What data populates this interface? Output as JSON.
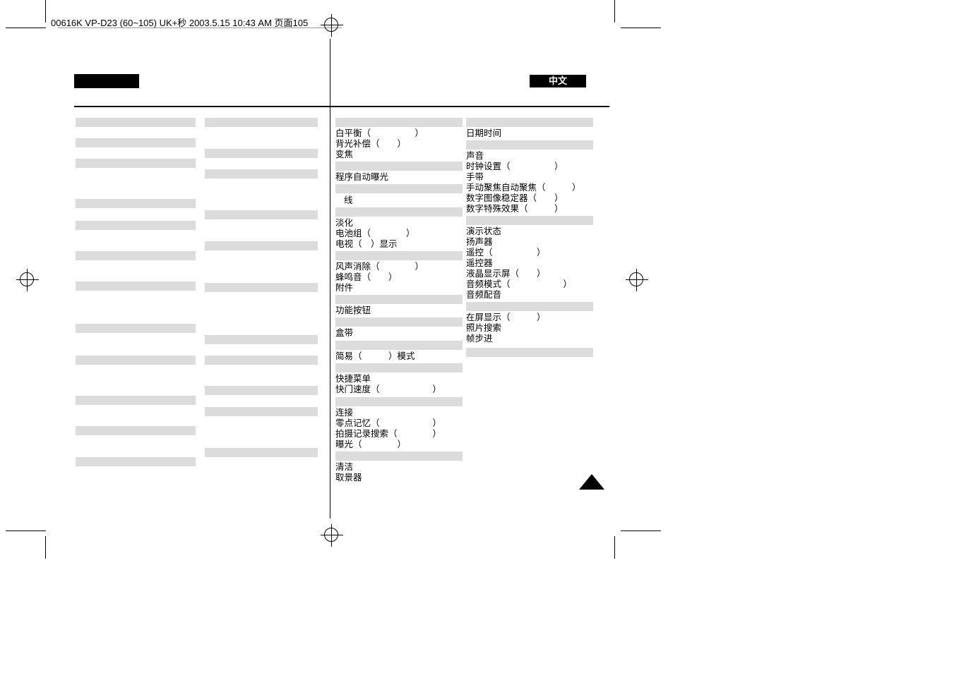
{
  "header": {
    "crop_label": "00616K VP-D23 (60~105) UK+秒  2003.5.15 10:43 AM  页面105"
  },
  "lang_tab": "中文",
  "col3": {
    "g1": "",
    "e1": "白平衡（　　　　　）",
    "e2": "背光补偿（　　）",
    "e3": "变焦",
    "g2": "",
    "e4": "程序自动曝光",
    "g3": "",
    "e5": "线",
    "g4": "",
    "e6": "淡化",
    "e7": "电池组（　　　　）",
    "e8": "电视（　）显示",
    "g5": "",
    "e9": "风声消除（　　　　）",
    "e10": "蜂鸣音（　　）",
    "e11": "附件",
    "g6": "",
    "e12": "功能按钮",
    "g7": "",
    "e13": "盒带",
    "g8": "",
    "e14": "简易（　　　）模式",
    "g9": "",
    "e15": "快捷菜单",
    "e16": "快门速度（　　　　　　）",
    "g10": "",
    "e17": "连接",
    "e18": "零点记忆（　　　　　　）",
    "e19": "拍摄记录搜索（　　　　）",
    "e20": "曝光（　　　　）",
    "g11": "",
    "e21": "清洁",
    "e22": "取景器"
  },
  "col4": {
    "g1": "",
    "e1": "日期时间",
    "g2": "",
    "e2": "声音",
    "e3": "时钟设置（　　　　　）",
    "e4": "手带",
    "e5": "手动聚焦自动聚焦（　　　）",
    "e6": "数字图像稳定器（　　）",
    "e7": "数字特殊效果（　　　）",
    "g3": "",
    "e8": "演示状态",
    "e9": "扬声器",
    "e10": "遥控（　　　　　）",
    "e11": "遥控器",
    "e12": "液晶显示屏（　　）",
    "e13": "音频模式（　　　　　　）",
    "e14": "音频配音",
    "g4": "",
    "e15": "在屏显示（　　　）",
    "e16": "照片搜索",
    "e17": "帧步进",
    "g5": ""
  }
}
